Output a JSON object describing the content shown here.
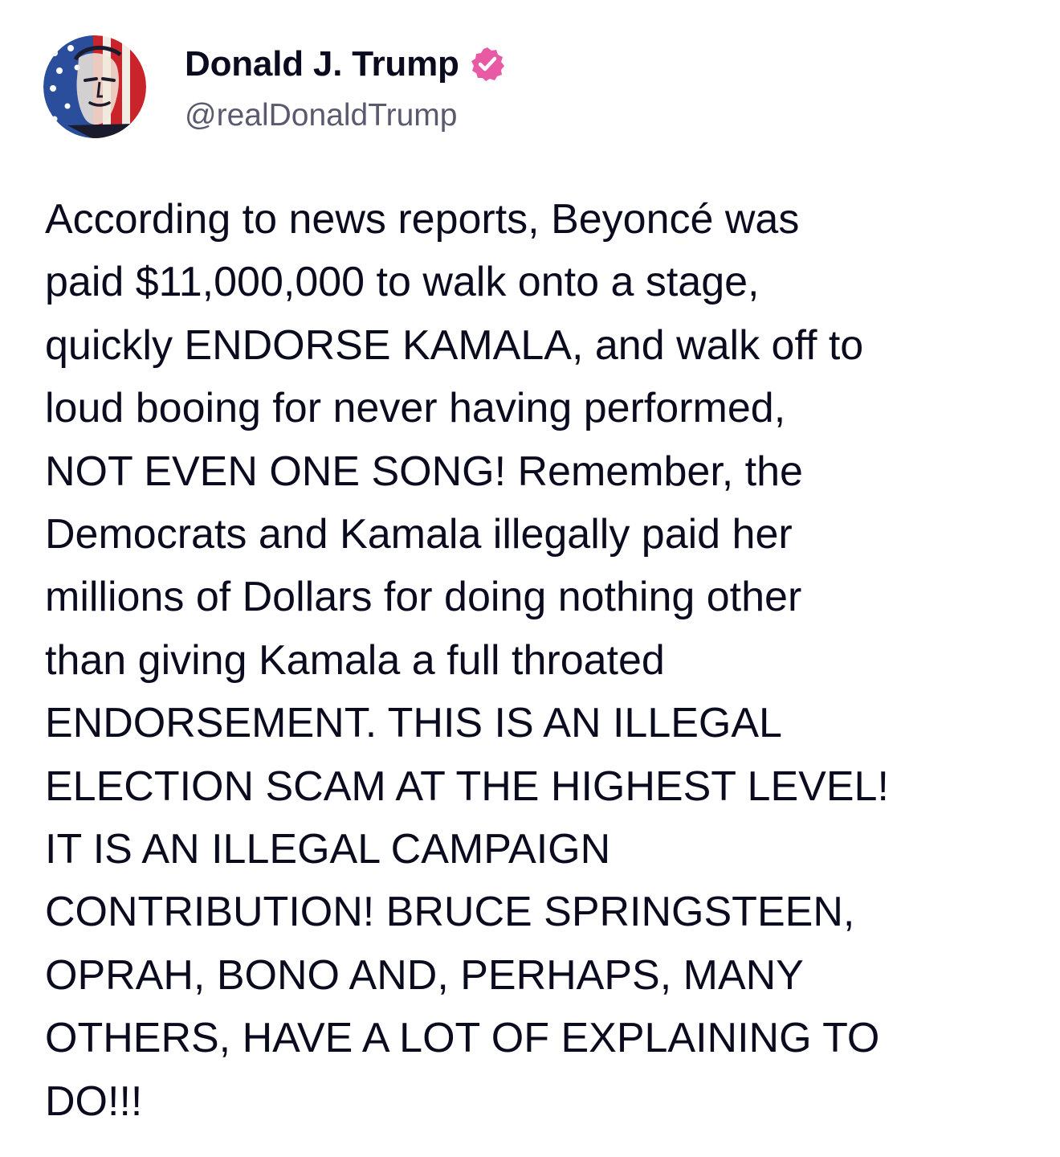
{
  "author": {
    "display_name": "Donald J. Trump",
    "handle": "@realDonaldTrump",
    "verified_badge_color": "#e85aa4"
  },
  "post": {
    "lines": [
      "According to news reports, Beyoncé was",
      "paid $11,000,000 to walk onto a stage,",
      "quickly ENDORSE KAMALA, and walk off to",
      "loud booing for never having performed,",
      "NOT EVEN ONE SONG! Remember, the",
      "Democrats and Kamala illegally paid her",
      "millions of Dollars for doing nothing other",
      "than giving Kamala a full throated",
      "ENDORSEMENT. THIS IS AN ILLEGAL",
      "ELECTION SCAM AT THE HIGHEST LEVEL!",
      "IT IS AN ILLEGAL CAMPAIGN",
      "CONTRIBUTION! BRUCE SPRINGSTEEN,",
      "OPRAH, BONO AND, PERHAPS, MANY",
      "OTHERS, HAVE A LOT OF EXPLAINING TO",
      "DO!!!"
    ]
  },
  "icons": {
    "avatar": "profile-photo-flag-portrait",
    "verified": "verified-badge-icon"
  }
}
